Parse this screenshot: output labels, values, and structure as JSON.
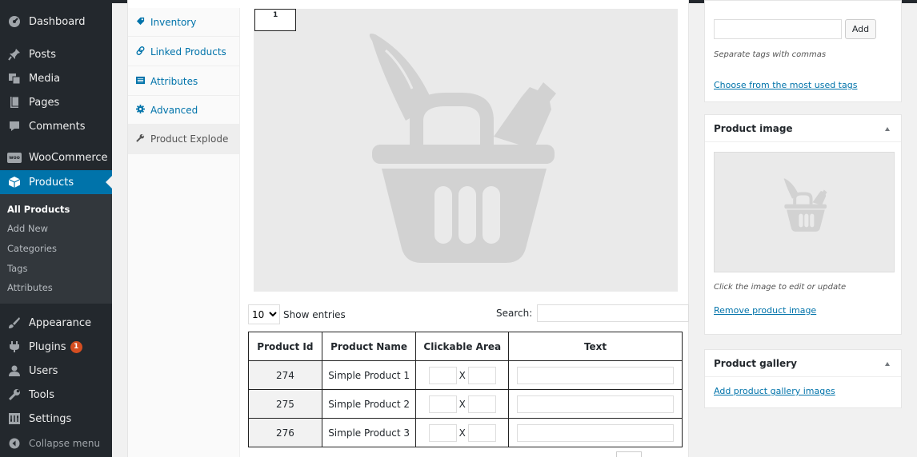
{
  "admin_menu": {
    "items": [
      {
        "label": "Dashboard",
        "icon": "dashboard-icon"
      },
      {
        "label": "Posts",
        "icon": "pin-icon"
      },
      {
        "label": "Media",
        "icon": "media-icon"
      },
      {
        "label": "Pages",
        "icon": "pages-icon"
      },
      {
        "label": "Comments",
        "icon": "comment-icon"
      },
      {
        "label": "WooCommerce",
        "icon": "woo-icon"
      },
      {
        "label": "Products",
        "icon": "cube-icon"
      },
      {
        "label": "Appearance",
        "icon": "brush-icon"
      },
      {
        "label": "Plugins",
        "icon": "plug-icon",
        "badge": "1"
      },
      {
        "label": "Users",
        "icon": "user-icon"
      },
      {
        "label": "Tools",
        "icon": "wrench-icon"
      },
      {
        "label": "Settings",
        "icon": "settings-icon"
      },
      {
        "label": "Collapse menu",
        "icon": "collapse-icon"
      }
    ],
    "woo_logo_text": "woo",
    "submenu": [
      "All Products",
      "Add New",
      "Categories",
      "Tags",
      "Attributes"
    ]
  },
  "product_tabs": [
    {
      "label": "Inventory",
      "icon": "tag-icon"
    },
    {
      "label": "Linked Products",
      "icon": "link-icon"
    },
    {
      "label": "Attributes",
      "icon": "list-icon"
    },
    {
      "label": "Advanced",
      "icon": "gear-icon"
    },
    {
      "label": "Product Explode",
      "icon": "wrench-icon"
    }
  ],
  "explode": {
    "area_marker": "1",
    "entries_value": "10",
    "show_entries": "Show entries",
    "search_label": "Search:",
    "columns": [
      "Product Id",
      "Product Name",
      "Clickable Area",
      "Text"
    ],
    "rows": [
      {
        "id": "274",
        "name": "Simple Product 1",
        "x": "X"
      },
      {
        "id": "275",
        "name": "Simple Product 2",
        "x": "X"
      },
      {
        "id": "276",
        "name": "Simple Product 3",
        "x": "X"
      }
    ]
  },
  "tags_box": {
    "add_label": "Add",
    "hint": "Separate tags with commas",
    "choose_link": "Choose from the most used tags"
  },
  "image_box": {
    "title": "Product image",
    "hint": "Click the image to edit or update",
    "remove_link": "Remove product image"
  },
  "gallery_box": {
    "title": "Product gallery",
    "add_link": "Add product gallery images"
  },
  "colors": {
    "accent": "#0073aa",
    "sidebar": "#23282d",
    "badge": "#d54e21"
  }
}
